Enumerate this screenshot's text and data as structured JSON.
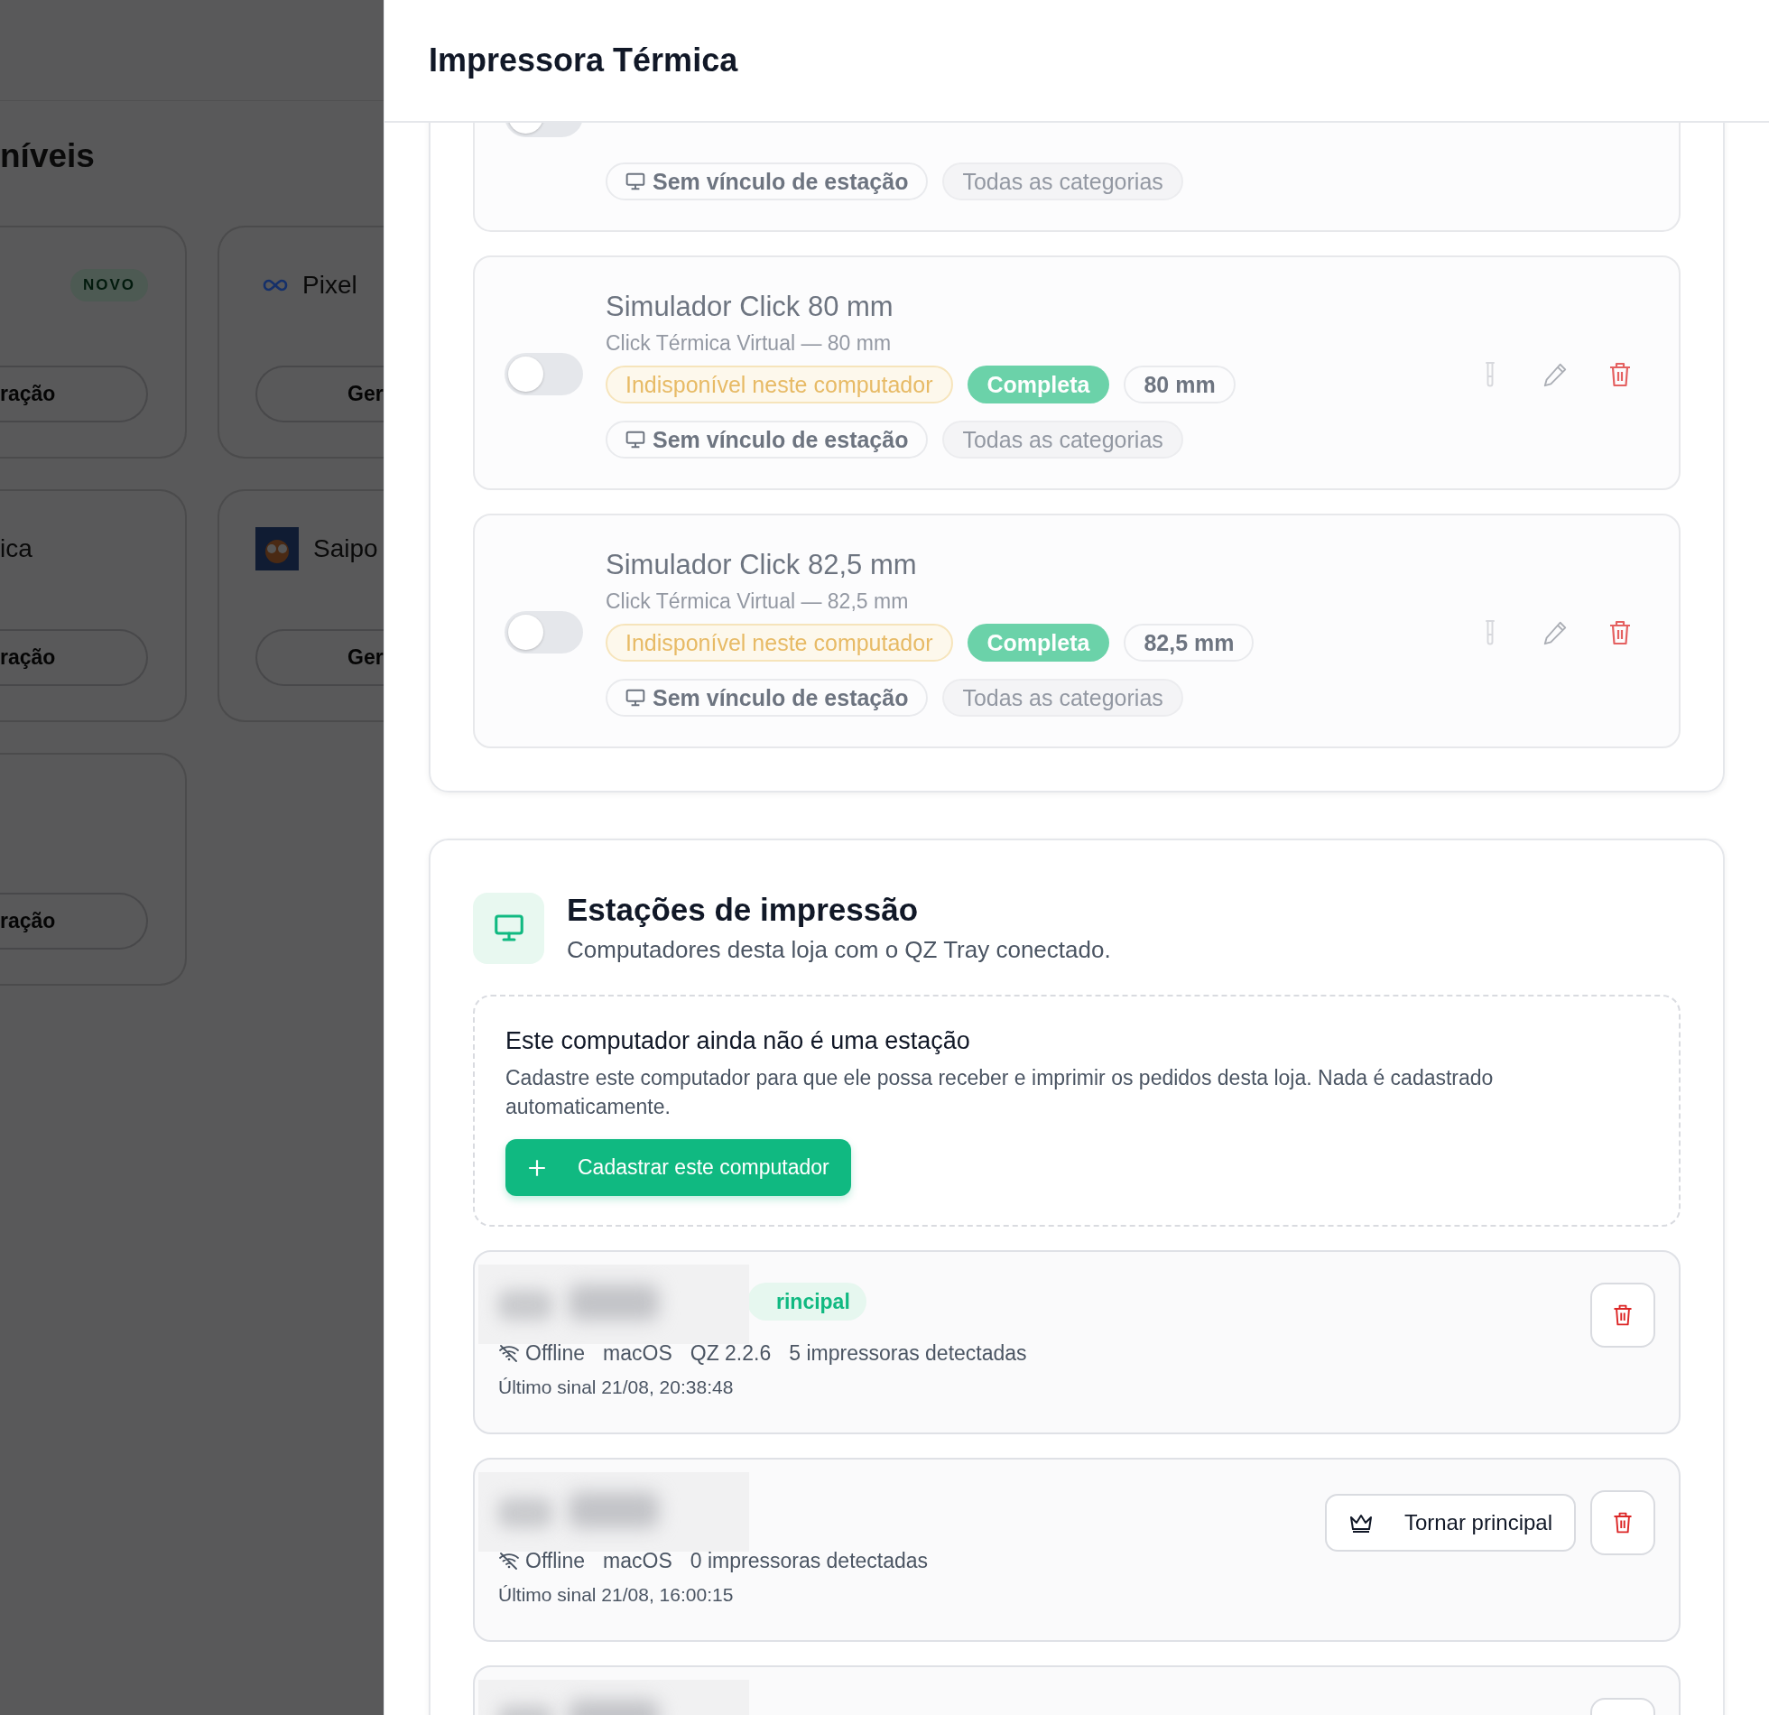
{
  "background_page": {
    "heading": "níveis",
    "cards": [
      {
        "badge": "NOVO",
        "button": "ração"
      },
      {
        "title": "Pixel",
        "button": "Ger"
      },
      {
        "title": "ica",
        "button": "ração"
      },
      {
        "title": "Saipo",
        "button": "Ger"
      },
      {
        "button": "ração"
      }
    ]
  },
  "drawer": {
    "title": "Impressora Térmica"
  },
  "printers": [
    {
      "on": false,
      "tags2": [
        {
          "kind": "station",
          "text": "Sem vínculo de estação"
        },
        {
          "kind": "categories",
          "text": "Todas as categorias"
        }
      ]
    },
    {
      "on": false,
      "name": "Simulador Click 80 mm",
      "subtitle": "Click Térmica Virtual — 80 mm",
      "tags": [
        {
          "kind": "unavailable",
          "text": "Indisponível neste computador"
        },
        {
          "kind": "complete",
          "text": "Completa"
        },
        {
          "kind": "width",
          "text": "80 mm"
        }
      ],
      "tags2": [
        {
          "kind": "station",
          "text": "Sem vínculo de estação"
        },
        {
          "kind": "categories",
          "text": "Todas as categorias"
        }
      ]
    },
    {
      "on": false,
      "name": "Simulador Click 82,5 mm",
      "subtitle": "Click Térmica Virtual — 82,5 mm",
      "tags": [
        {
          "kind": "unavailable",
          "text": "Indisponível neste computador"
        },
        {
          "kind": "complete",
          "text": "Completa"
        },
        {
          "kind": "width",
          "text": "82,5 mm"
        }
      ],
      "tags2": [
        {
          "kind": "station",
          "text": "Sem vínculo de estação"
        },
        {
          "kind": "categories",
          "text": "Todas as categorias"
        }
      ]
    }
  ],
  "stations": {
    "title": "Estações de impressão",
    "subtitle": "Computadores desta loja com o QZ Tray conectado.",
    "notice": {
      "title": "Este computador ainda não é uma estação",
      "text": "Cadastre este computador para que ele possa receber e imprimir os pedidos desta loja. Nada é cadastrado automaticamente.",
      "button": "Cadastrar este computador"
    },
    "items": [
      {
        "kind": "station",
        "badge": "rincipal",
        "online": false,
        "status": "Offline",
        "details": [
          "macOS",
          "QZ 2.2.6",
          "5 impressoras detectadas"
        ],
        "last_seen": "Último sinal 21/08, 20:38:48"
      },
      {
        "kind": "station",
        "action": "Tornar principal",
        "online": false,
        "status": "Offline",
        "details": [
          "macOS",
          "0 impressoras detectadas"
        ],
        "last_seen": "Último sinal 21/08, 16:00:15"
      },
      {
        "kind": "station"
      }
    ]
  }
}
